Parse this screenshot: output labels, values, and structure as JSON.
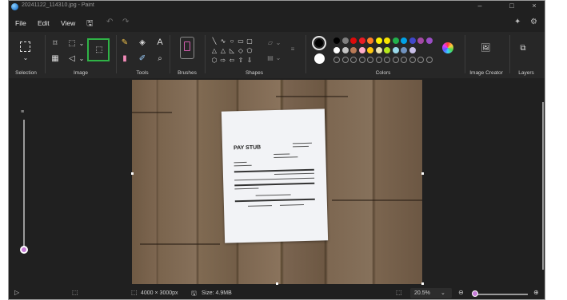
{
  "window": {
    "title": "20241122_114310.jpg - Paint",
    "minimize_glyph": "–",
    "maximize_glyph": "□",
    "close_glyph": "×"
  },
  "menu": {
    "file": "File",
    "edit": "Edit",
    "view": "View"
  },
  "ribbon": {
    "groups": {
      "selection": "Selection",
      "image": "Image",
      "tools": "Tools",
      "brushes": "Brushes",
      "shapes": "Shapes",
      "colors": "Colors",
      "image_creator": "Image Creator",
      "layers": "Layers"
    },
    "tools": {
      "text_glyph": "A"
    },
    "palette_row1": [
      "#000000",
      "#7f7f7f",
      "#e00a0a",
      "#ed1c24",
      "#ff7f27",
      "#fff200",
      "#f9e400",
      "#22b14c",
      "#00a2e8",
      "#3f48cc",
      "#a349a4",
      "#9b4ec6"
    ],
    "palette_row2": [
      "#ffffff",
      "#c3c3c3",
      "#b97a57",
      "#ffaec9",
      "#ffc90e",
      "#efe4b0",
      "#b5e61d",
      "#99d9ea",
      "#7092be",
      "#c8bfe7"
    ],
    "primary_color": "#000000",
    "secondary_color": "#ffffff"
  },
  "document": {
    "paystub_title": "PAY STUB"
  },
  "status": {
    "dimensions": "4000 × 3000px",
    "size": "Size: 4.9MB",
    "zoom": "20.5%"
  }
}
